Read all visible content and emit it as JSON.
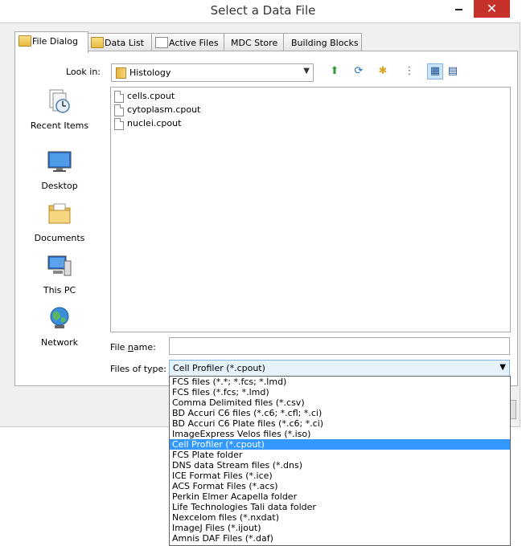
{
  "window": {
    "title": "Select a Data File"
  },
  "tabs": [
    {
      "label": "File Dialog",
      "active": true
    },
    {
      "label": "Data List"
    },
    {
      "label": "Active Files"
    },
    {
      "label": "MDC Store"
    },
    {
      "label": "Building Blocks"
    }
  ],
  "look_in": {
    "label": "Look in:",
    "value": "Histology"
  },
  "places": [
    {
      "label": "Recent Items",
      "icon": "recent-items-icon"
    },
    {
      "label": "Desktop",
      "icon": "desktop-icon"
    },
    {
      "label": "Documents",
      "icon": "documents-icon"
    },
    {
      "label": "This PC",
      "icon": "this-pc-icon"
    },
    {
      "label": "Network",
      "icon": "network-icon"
    }
  ],
  "files": [
    "cells.cpout",
    "cytoplasm.cpout",
    "nuclei.cpout"
  ],
  "file_name": {
    "label_pre": "File ",
    "label_underlined": "n",
    "label_post": "ame:",
    "value": ""
  },
  "file_type": {
    "label": "Files of type:",
    "value": "Cell Profiler (*.cpout)",
    "options": [
      "FCS files (*.*; *.fcs; *.lmd)",
      "FCS files (*.fcs; *.lmd)",
      "Comma Delimited files (*.csv)",
      "BD Accuri C6 files (*.c6; *.cfl; *.ci)",
      "BD Accuri C6 Plate files (*.c6; *.ci)",
      "ImageExpress Velos files (*.iso)",
      "Cell Profiler (*.cpout)",
      "FCS Plate folder",
      "DNS data Stream files (*.dns)",
      "ICE Format Files (*.ice)",
      "ACS Format Files (*.acs)",
      "Perkin Elmer Acapella folder",
      "Life Technologies Tali data folder",
      "Nexcelom files (*.nxdat)",
      "ImageJ Files (*.ijout)",
      "Amnis DAF Files (*.daf)"
    ],
    "selected_index": 6
  },
  "colors": {
    "accent": "#3399ff",
    "close": "#c7312c"
  }
}
